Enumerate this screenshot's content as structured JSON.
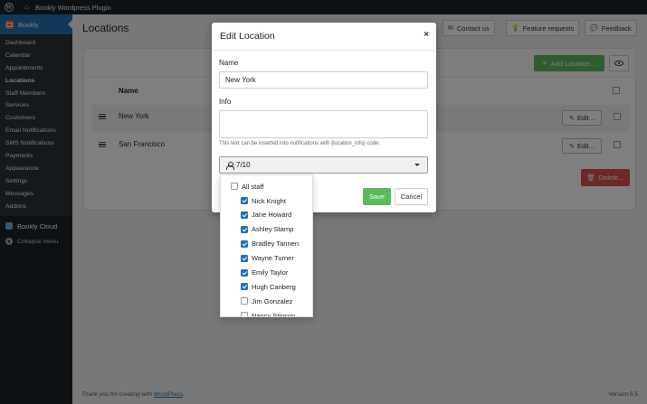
{
  "adminbar": {
    "site_name": "Bookly Wordpress Plugin"
  },
  "sidebar": {
    "plugin_label": "Bookly",
    "items": [
      "Dashboard",
      "Calendar",
      "Appointments",
      "Locations",
      "Staff Members",
      "Services",
      "Customers",
      "Email Notifications",
      "SMS Notifications",
      "Payments",
      "Appearance",
      "Settings",
      "Messages",
      "Addons"
    ],
    "active": "Locations",
    "cloud_label": "Bookly Cloud",
    "collapse_label": "Collapse menu"
  },
  "page": {
    "title": "Locations",
    "top_buttons": {
      "contact": "Contact us",
      "feature": "Feature requests",
      "feedback": "Feedback"
    },
    "add_button": "Add Location...",
    "table_header": "Name",
    "rows": [
      {
        "name": "New York",
        "edit": "Edit..."
      },
      {
        "name": "San Francisco",
        "edit": "Edit..."
      }
    ],
    "delete_button": "Delete..."
  },
  "modal": {
    "title": "Edit Location",
    "close": "×",
    "name_label": "Name",
    "name_value": "New York",
    "info_label": "Info",
    "info_value": "",
    "help_text": "This text can be inserted into notifications with {location_info} code.",
    "staff_count": "7/10",
    "save": "Save",
    "cancel": "Cancel"
  },
  "staff_dropdown": {
    "all_label": "All staff",
    "all_checked": false,
    "staff": [
      {
        "name": "Nick Knight",
        "checked": true
      },
      {
        "name": "Jane Howard",
        "checked": true
      },
      {
        "name": "Ashley Stamp",
        "checked": true
      },
      {
        "name": "Bradley Tannen",
        "checked": true
      },
      {
        "name": "Wayne Turner",
        "checked": true
      },
      {
        "name": "Emily Taylor",
        "checked": true
      },
      {
        "name": "Hugh Canberg",
        "checked": true
      },
      {
        "name": "Jim Gonzalez",
        "checked": false
      },
      {
        "name": "Nancy Stinson",
        "checked": false
      }
    ]
  },
  "footer": {
    "thanks_prefix": "Thank you for creating with ",
    "thanks_link": "WordPress",
    "thanks_suffix": ".",
    "version": "Version 5.5"
  },
  "colors": {
    "accent": "#2271b1",
    "success": "#5cb85c",
    "danger": "#d9534f",
    "admin_dark": "#1d2327"
  }
}
